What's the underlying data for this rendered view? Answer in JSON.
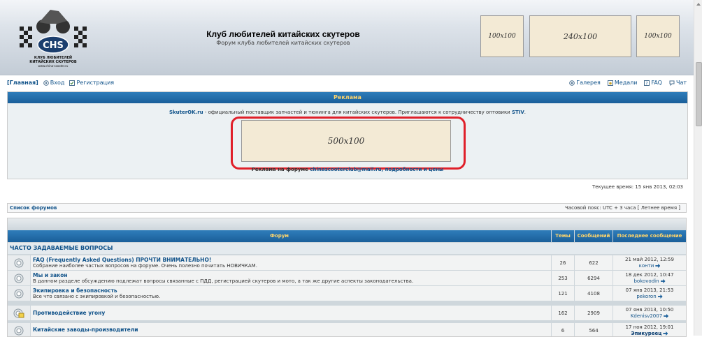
{
  "header": {
    "logo_text": "CHS",
    "logo_caption1": "КЛУБ ЛЮБИТЕЛЕЙ",
    "logo_caption2": "КИТАЙСКИХ СКУТЕРОВ",
    "logo_caption3": "www.china-scooter.ru",
    "title": "Клуб любителей китайских скутеров",
    "description": "Форум клуба любителей китайских скутеров",
    "ad1": "100x100",
    "ad2": "240x100",
    "ad3": "100x100"
  },
  "nav": {
    "home": "[Главная]",
    "login": "Вход",
    "register": "Регистрация",
    "gallery": "Галерея",
    "medals": "Медали",
    "faq": "FAQ",
    "chat": "Чат"
  },
  "advert": {
    "bar_title": "Реклама",
    "line_link": "SkuterOK.ru",
    "line_text": " - официальный поставщик запчастей и тюнинга для китайских скутеров. Приглашаются к сотрудничеству оптовики ",
    "line_link2": "STIV",
    "line_end": ".",
    "big_ad": "500x100",
    "footer_text": "Реклама на форуме ",
    "footer_link": "chinascooterclub@mail.ru, подробности и цены"
  },
  "current_time": "Текущее время: 15 янв 2013, 02:03",
  "index_bar": {
    "left": "Список форумов",
    "right": "Часовой пояс: UTC + 3 часа [ Летнее время ]"
  },
  "table": {
    "col_forum": "Форум",
    "col_topics": "Темы",
    "col_posts": "Сообщений",
    "col_last": "Последнее сообщение",
    "category": "ЧАСТО ЗАДАВАЕМЫЕ ВОПРОСЫ",
    "rows": [
      {
        "name": "FAQ (Frequently Asked Questions) ПРОЧТИ ВНИМАТЕЛЬНО!",
        "desc": "Собрание наиболее частых вопросов на форуме. Очень полезно почитать НОВИЧКАМ.",
        "topics": "26",
        "posts": "622",
        "date": "21 май 2012, 12:59",
        "user": "конти"
      },
      {
        "name": "Мы и закон",
        "desc": "В данном разделе обсуждению подлежат вопросы связанные с ПДД, регистрацией скутеров и мото, а так же другие аспекты законодательства.",
        "topics": "253",
        "posts": "6294",
        "date": "18 дек 2012, 10:47",
        "user": "bokovodin"
      },
      {
        "name": "Экипировка и безопасность",
        "desc": "Все что связано с экипировкой и безопасностью.",
        "topics": "121",
        "posts": "4108",
        "date": "07 янв 2013, 21:53",
        "user": "pekoron"
      },
      {
        "name": "Противодействие угону",
        "desc": "",
        "topics": "162",
        "posts": "2909",
        "date": "07 янв 2013, 10:50",
        "user": "Kdenisv2007"
      },
      {
        "name": "Китайские заводы-производители",
        "desc": "",
        "topics": "6",
        "posts": "564",
        "date": "17 ноя 2012, 19:01",
        "user": "Эпикуреец"
      }
    ]
  }
}
